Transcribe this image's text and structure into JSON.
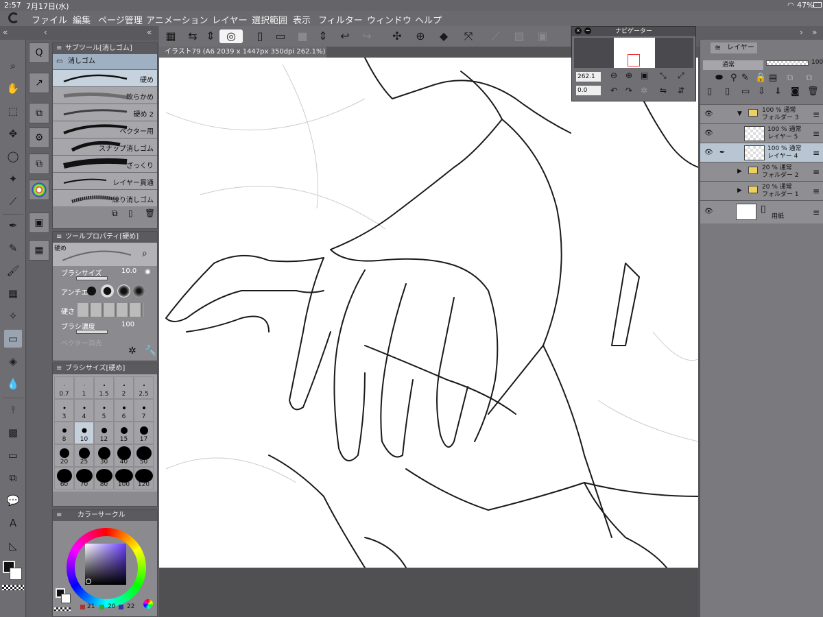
{
  "status": {
    "time": "2:57",
    "date": "7月17日(水)",
    "battery": "47%"
  },
  "menu": [
    "ファイル",
    "編集",
    "ページ管理",
    "アニメーション",
    "レイヤー",
    "選択範囲",
    "表示",
    "フィルター",
    "ウィンドウ",
    "ヘルプ"
  ],
  "subtool": {
    "title": "サブツール[消しゴム]",
    "group": "消しゴム",
    "items": [
      "硬め",
      "軟らかめ",
      "硬め 2",
      "ベクター用",
      "スナップ消しゴム",
      "ざっくり",
      "レイヤー貫通",
      "練り消しゴム"
    ]
  },
  "toolprop": {
    "title": "ツールプロパティ[硬め]",
    "preset": "硬め",
    "brush_size_label": "ブラシサイズ",
    "brush_size_value": "10.0",
    "antialias_label": "アンチエ",
    "hardness_label": "硬さ",
    "density_label": "ブラシ濃度",
    "density_value": "100",
    "vector_label": "ベクター消去"
  },
  "brushsize": {
    "title": "ブラシサイズ[硬め]",
    "sizes": [
      "0.7",
      "1",
      "1.5",
      "2",
      "2.5",
      "3",
      "4",
      "5",
      "6",
      "7",
      "8",
      "10",
      "12",
      "15",
      "17",
      "20",
      "25",
      "30",
      "40",
      "50",
      "60",
      "70",
      "80",
      "100",
      "120"
    ],
    "selected": "10"
  },
  "colorcircle": {
    "title": "カラーサークル",
    "r": "21",
    "g": "20",
    "b": "22"
  },
  "document": {
    "tab": "イラスト79 (A6 2039 x 1447px 350dpi 262.1%)"
  },
  "navigator": {
    "title": "ナビゲーター",
    "zoom": "262.1",
    "angle": "0.0"
  },
  "layers": {
    "tab": "レイヤー",
    "blend_mode": "通常",
    "opacity": "100",
    "rows": [
      {
        "line1": "100 % 通常",
        "line2": "フォルダー 3"
      },
      {
        "line1": "100 % 通常",
        "line2": "レイヤー 5"
      },
      {
        "line1": "100 % 通常",
        "line2": "レイヤー 4"
      },
      {
        "line1": "20 % 通常",
        "line2": "フォルダー 2"
      },
      {
        "line1": "20 % 通常",
        "line2": "フォルダー 1"
      },
      {
        "line1": "",
        "line2": "用紙"
      }
    ]
  },
  "toolbox_letter": "A"
}
